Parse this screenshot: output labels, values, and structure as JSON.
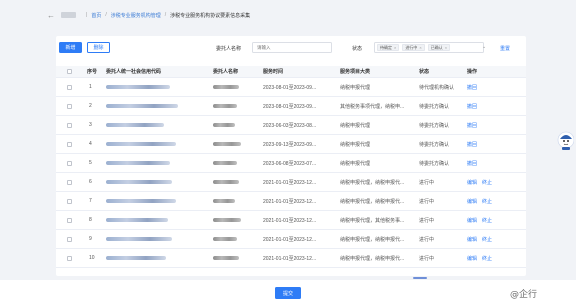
{
  "breadcrumb": {
    "items": [
      "首页",
      "涉税专业服务机构管理",
      "涉税专业服务机构协议要素信息采集"
    ]
  },
  "toolbar": {
    "add_label": "新增",
    "delete_label": "删除",
    "client_name_label": "委托人名称",
    "client_name_placeholder": "请输入",
    "status_label": "状态",
    "status_tags": [
      "待确定",
      "进行中",
      "已确认"
    ],
    "reset_label": "重置"
  },
  "table": {
    "headers": [
      "序号",
      "委托人统一社会信用代码",
      "委托人名称",
      "服务时间",
      "服务项目大类",
      "状态",
      "操作"
    ],
    "rows": [
      {
        "no": "1",
        "time": "2023-08-01至2023-09...",
        "category": "纳税申报代理",
        "status": "待代理机构确认",
        "ops": [
          "撤回"
        ]
      },
      {
        "no": "2",
        "time": "2023-08-01至2023-09...",
        "category": "其他税务事项代理，纳税申...",
        "status": "待委托方确认",
        "ops": [
          "撤回"
        ]
      },
      {
        "no": "3",
        "time": "2023-06-03至2023-08...",
        "category": "纳税申报代理",
        "status": "待委托方确认",
        "ops": [
          "撤回"
        ]
      },
      {
        "no": "4",
        "time": "2023-09-13至2023-09...",
        "category": "纳税申报代理",
        "status": "待委托方确认",
        "ops": [
          "撤回"
        ]
      },
      {
        "no": "5",
        "time": "2023-06-08至2023-07...",
        "category": "纳税申报代理",
        "status": "待委托方确认",
        "ops": [
          "撤回"
        ]
      },
      {
        "no": "6",
        "time": "2021-01-01至2023-12...",
        "category": "纳税申报代理，纳税申报代...",
        "status": "进行中",
        "ops": [
          "编辑",
          "终止"
        ]
      },
      {
        "no": "7",
        "time": "2021-01-01至2023-12...",
        "category": "纳税申报代理，纳税申报代...",
        "status": "进行中",
        "ops": [
          "编辑",
          "终止"
        ]
      },
      {
        "no": "8",
        "time": "2021-01-01至2023-12...",
        "category": "纳税申报代理，其他税务事...",
        "status": "进行中",
        "ops": [
          "编辑",
          "终止"
        ]
      },
      {
        "no": "9",
        "time": "2021-01-01至2023-12...",
        "category": "纳税申报代理，纳税申报代...",
        "status": "进行中",
        "ops": [
          "编辑",
          "终止"
        ]
      },
      {
        "no": "10",
        "time": "2021-01-01至2023-12...",
        "category": "纳税申报代理，纳税申报代...",
        "status": "进行中",
        "ops": [
          "编辑",
          "终止"
        ]
      }
    ]
  },
  "footer": {
    "submit_label": "提交"
  },
  "watermark": "@企行",
  "colors": {
    "primary": "#2e7cf6",
    "background": "#f1f3f7"
  }
}
